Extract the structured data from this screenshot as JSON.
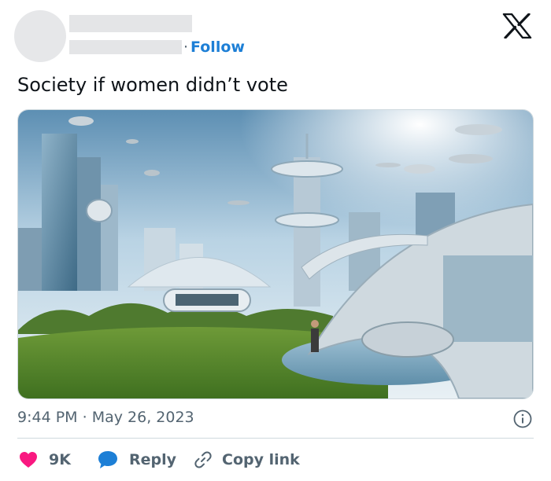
{
  "header": {
    "follow_separator": "·",
    "follow_label": "Follow",
    "logo_icon": "x-logo-icon"
  },
  "tweet": {
    "text": "Society if women didn’t vote"
  },
  "meta": {
    "time": "9:44 PM",
    "separator": "·",
    "date": "May 26, 2023",
    "info_icon": "info-icon"
  },
  "actions": {
    "like_count": "9K",
    "reply_label": "Reply",
    "copy_label": "Copy link",
    "icons": [
      "heart-icon",
      "speech-bubble-icon",
      "link-icon"
    ]
  },
  "colors": {
    "accent": "#1d7fd6",
    "heart": "#f91880",
    "muted": "#536471",
    "text": "#0f1419"
  }
}
